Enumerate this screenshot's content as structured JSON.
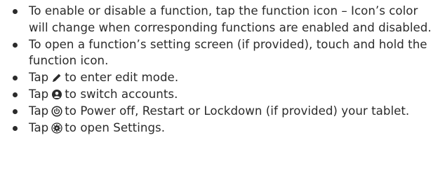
{
  "instructions": {
    "items": [
      {
        "text": "To enable or disable a function, tap the function icon – Icon’s color will change when corresponding functions are enabled and disabled."
      },
      {
        "text": "To open a function’s setting screen (if provided), touch and hold the function icon."
      },
      {
        "before": "Tap",
        "icon": "pencil-icon",
        "after": "to enter edit mode."
      },
      {
        "before": "Tap",
        "icon": "account-icon",
        "after": "to switch accounts."
      },
      {
        "before": "Tap",
        "icon": "power-icon",
        "after": "to Power off, Restart or Lockdown (if provided) your tablet."
      },
      {
        "before": "Tap",
        "icon": "settings-gear-icon",
        "after": "to open Settings."
      }
    ]
  },
  "colors": {
    "text": "#2b2b2b",
    "background": "#ffffff"
  }
}
